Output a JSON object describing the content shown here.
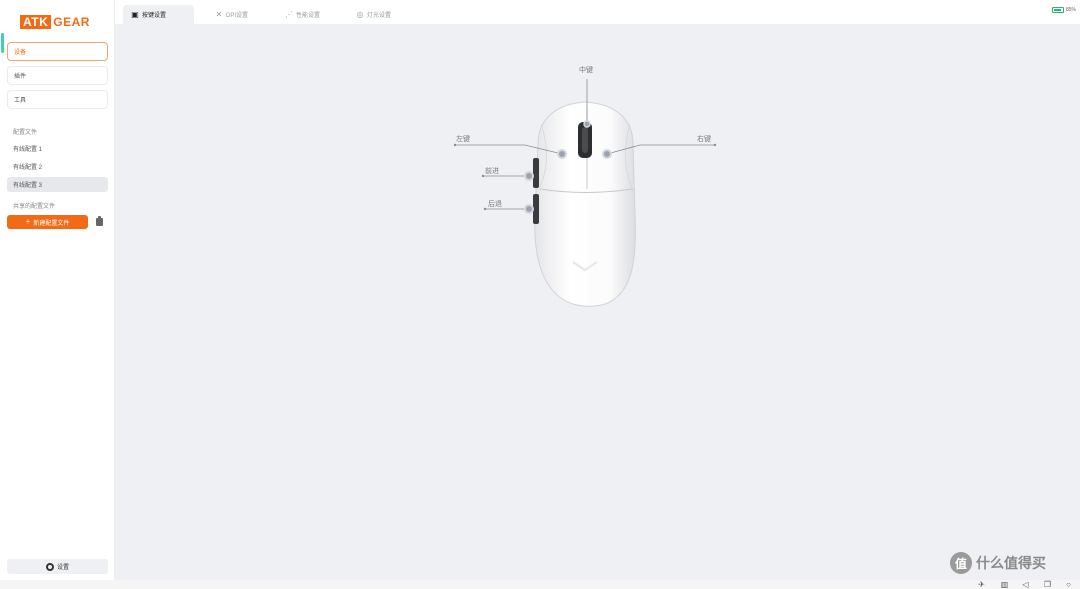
{
  "logo": {
    "box": "ATK",
    "text": "GEAR"
  },
  "sidebar": {
    "nav": [
      {
        "label": "设备"
      },
      {
        "label": "插件"
      },
      {
        "label": "工具"
      }
    ],
    "profiles_label": "配置文件",
    "profiles": [
      {
        "label": "有线配置 1"
      },
      {
        "label": "有线配置 2"
      },
      {
        "label": "有线配置 3"
      }
    ],
    "shared_label": "共享的配置文件",
    "new_profile_button": "新建配置文件",
    "settings_button": "设置"
  },
  "tabs": [
    {
      "label": "按键设置",
      "icon": "key-settings-icon"
    },
    {
      "label": "DPI设置",
      "icon": "dpi-icon"
    },
    {
      "label": "性能设置",
      "icon": "performance-icon"
    },
    {
      "label": "灯光设置",
      "icon": "light-icon"
    }
  ],
  "battery": {
    "level": 85,
    "text": "85%"
  },
  "mouse": {
    "callouts": {
      "middle": "中键",
      "left": "左键",
      "right": "右键",
      "forward": "前进",
      "back": "后退"
    }
  },
  "watermark": {
    "glyph": "值",
    "text": "什么值得买"
  },
  "colors": {
    "accent": "#f26a16",
    "content_bg": "#eef0f3",
    "battery": "#2bb673"
  }
}
